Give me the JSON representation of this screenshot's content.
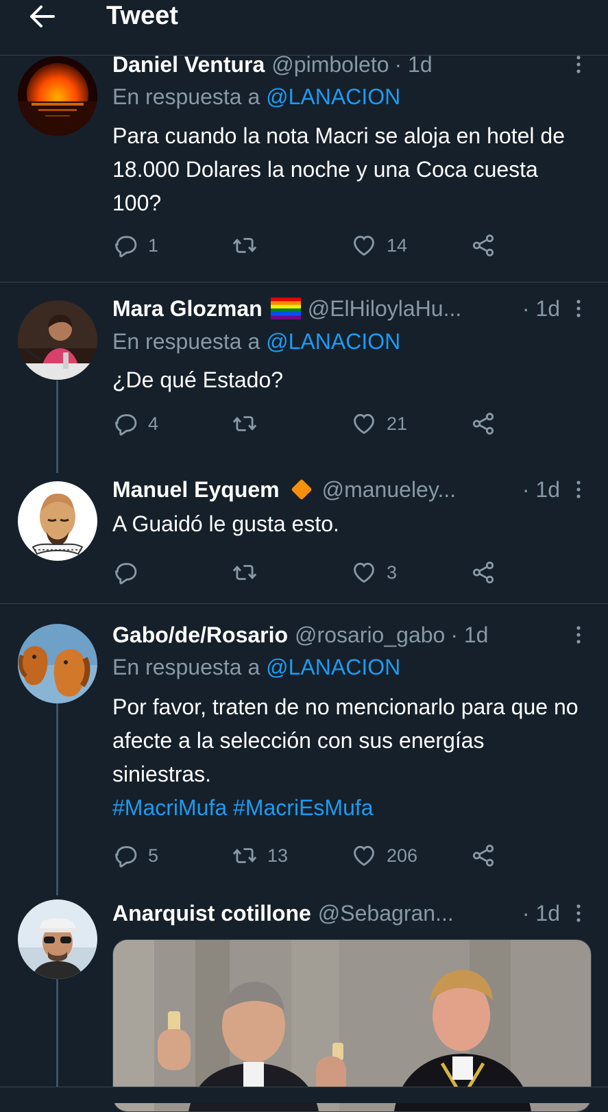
{
  "header": {
    "title": "Tweet"
  },
  "tweets": [
    {
      "name": "Daniel Ventura",
      "handle": "@pimboleto",
      "time": "· 1d",
      "reply_prefix": "En respuesta a",
      "reply_to": "@LANACION",
      "text": "Para cuando la nota Macri se aloja en hotel de 18.000 Dolares la noche y una Coca cuesta 100?",
      "replies": "1",
      "retweets": "",
      "likes": "14"
    },
    {
      "name": "Mara Glozman",
      "handle": "@ElHiloylaHu...",
      "time": "· 1d",
      "reply_prefix": "En respuesta a",
      "reply_to": "@LANACION",
      "text": "¿De qué Estado?",
      "replies": "4",
      "retweets": "",
      "likes": "21"
    },
    {
      "name": "Manuel Eyquem",
      "handle": "@manueley...",
      "time": "· 1d",
      "text": "A Guaidó le gusta esto.",
      "replies": "",
      "retweets": "",
      "likes": "3"
    },
    {
      "name": "Gabo/de/Rosario",
      "handle": "@rosario_gabo",
      "time": "· 1d",
      "reply_prefix": "En respuesta a",
      "reply_to": "@LANACION",
      "text": "Por favor, traten de no mencionarlo para que no afecte a la selección con sus energías siniestras.",
      "hashtags": "#MacriMufa #MacriEsMufa",
      "replies": "5",
      "retweets": "13",
      "likes": "206"
    },
    {
      "name": "Anarquist cotillone",
      "handle": "@Sebagran...",
      "time": "· 1d"
    }
  ],
  "colors": {
    "background": "#15202b",
    "divider": "#38444d",
    "link": "#1d9bf0",
    "muted": "#8899a6",
    "verified_diamond": "#f4900c"
  }
}
